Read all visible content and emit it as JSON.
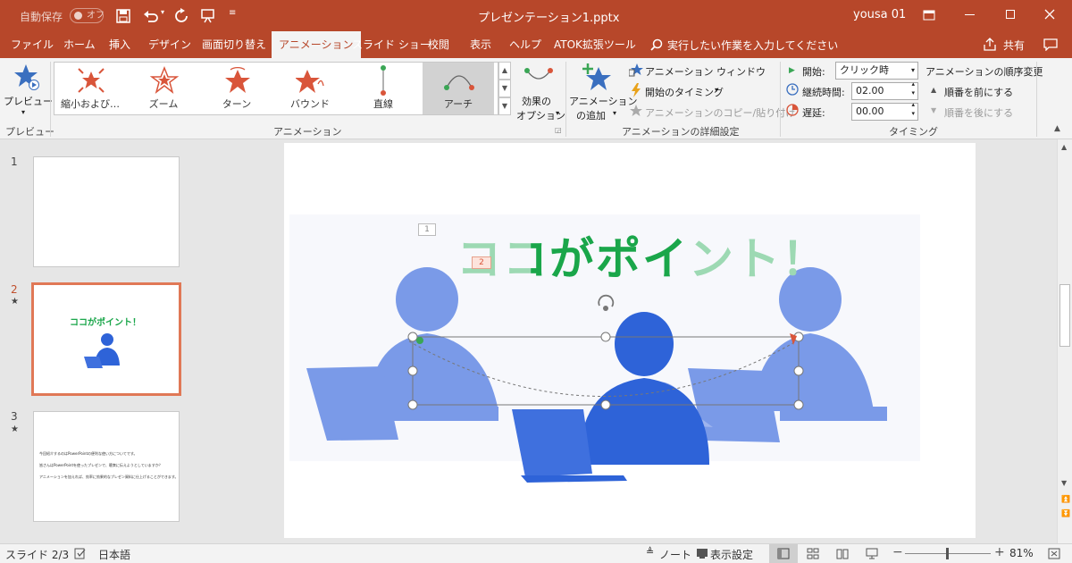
{
  "titlebar": {
    "autosave_label": "自動保存",
    "autosave_toggle": "オフ",
    "filename": "プレゼンテーション1.pptx",
    "user": "yousa 01"
  },
  "tabs": [
    "ファイル",
    "ホーム",
    "挿入",
    "デザイン",
    "画面切り替え",
    "アニメーション",
    "スライド ショー",
    "校閲",
    "表示",
    "ヘルプ",
    "ATOK拡張ツール"
  ],
  "active_tab": "アニメーション",
  "search_placeholder": "実行したい作業を入力してください",
  "share_label": "共有",
  "ribbon": {
    "preview": {
      "button": "プレビュー",
      "group": "プレビュー"
    },
    "animation": {
      "group": "アニメーション",
      "items": [
        "縮小および…",
        "ズーム",
        "ターン",
        "バウンド",
        "直線",
        "アーチ"
      ],
      "effect_options": [
        "効果の",
        "オプション"
      ]
    },
    "advanced": {
      "group": "アニメーションの詳細設定",
      "add_animation": [
        "アニメーション",
        "の追加"
      ],
      "animation_window": "アニメーション ウィンドウ",
      "trigger": "開始のタイミング",
      "copy_paste": "アニメーションのコピー/貼り付け"
    },
    "timing": {
      "group": "タイミング",
      "start_label": "開始:",
      "start_value": "クリック時",
      "duration_label": "継続時間:",
      "duration_value": "02.00",
      "delay_label": "遅延:",
      "delay_value": "00.00",
      "reorder_title": "アニメーションの順序変更",
      "move_earlier": "順番を前にする",
      "move_later": "順番を後にする"
    }
  },
  "slides": [
    {
      "number": "1",
      "star": ""
    },
    {
      "number": "2",
      "star": "★",
      "title": "ココがポイント！"
    },
    {
      "number": "3",
      "star": "★",
      "lines": [
        "今回紹介するのはPowerPointの便利な使い方についてです。",
        "皆さんはPowerPointを使ったプレゼンで、聴衆に伝えようとしていますか？",
        "アニメーションを加えれば、効率に効果的なプレゼン資料に仕上げることができます。"
      ]
    }
  ],
  "slide_main": {
    "title": "ココがポイント！",
    "tag1": "1",
    "tag2": "2"
  },
  "status": {
    "slide": "スライド 2/3",
    "language": "日本語",
    "notes": "ノート",
    "display": "表示設定",
    "zoom": "81%"
  },
  "colors": {
    "accent": "#b7472a",
    "title_green": "#1aa64a",
    "title_faded": "#9dd9b3",
    "person_dark": "#2e63d8",
    "person_light": "#7a9ae8"
  },
  "icons": [
    "star-icon",
    "save-icon",
    "undo-icon",
    "redo-icon",
    "present-icon",
    "search-icon",
    "share-icon",
    "comment-icon"
  ]
}
